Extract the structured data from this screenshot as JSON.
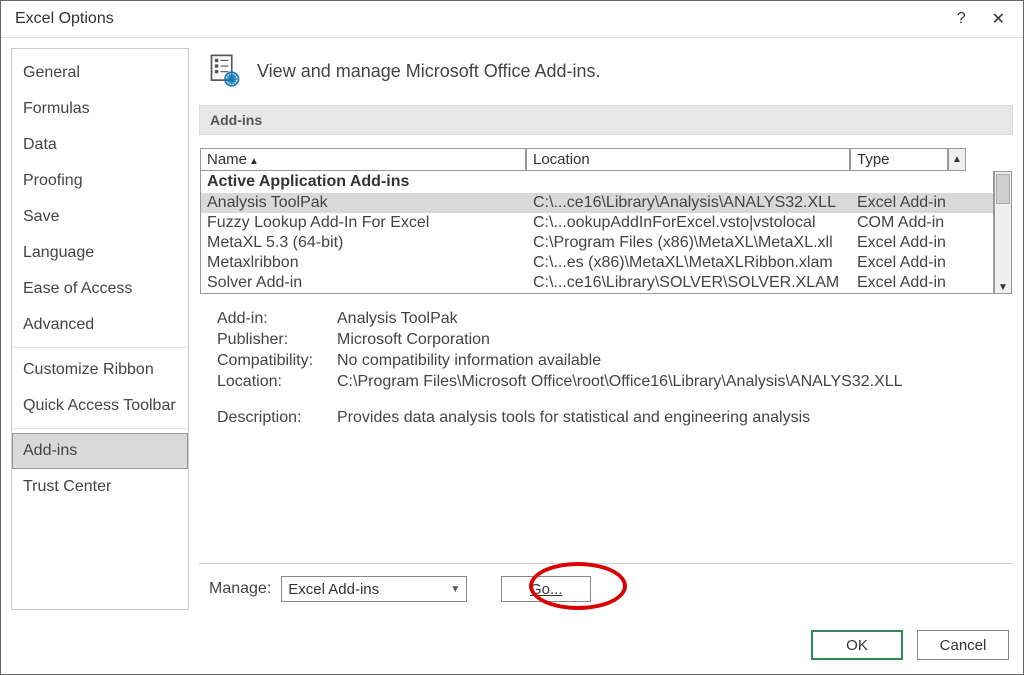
{
  "window": {
    "title": "Excel Options"
  },
  "sidebar": {
    "groups": [
      [
        "General",
        "Formulas",
        "Data",
        "Proofing",
        "Save",
        "Language",
        "Ease of Access",
        "Advanced"
      ],
      [
        "Customize Ribbon",
        "Quick Access Toolbar"
      ],
      [
        "Add-ins",
        "Trust Center"
      ]
    ],
    "selected": "Add-ins"
  },
  "header": {
    "text": "View and manage Microsoft Office Add-ins."
  },
  "section_title": "Add-ins",
  "table": {
    "columns": {
      "name": "Name",
      "location": "Location",
      "type": "Type"
    },
    "group_header": "Active Application Add-ins",
    "rows": [
      {
        "name": "Analysis ToolPak",
        "location": "C:\\...ce16\\Library\\Analysis\\ANALYS32.XLL",
        "type": "Excel Add-in",
        "selected": true
      },
      {
        "name": "Fuzzy Lookup Add-In For Excel",
        "location": "C:\\...ookupAddInForExcel.vsto|vstolocal",
        "type": "COM Add-in",
        "selected": false
      },
      {
        "name": "MetaXL 5.3 (64-bit)",
        "location": "C:\\Program Files (x86)\\MetaXL\\MetaXL.xll",
        "type": "Excel Add-in",
        "selected": false
      },
      {
        "name": "Metaxlribbon",
        "location": "C:\\...es (x86)\\MetaXL\\MetaXLRibbon.xlam",
        "type": "Excel Add-in",
        "selected": false
      },
      {
        "name": "Solver Add-in",
        "location": "C:\\...ce16\\Library\\SOLVER\\SOLVER.XLAM",
        "type": "Excel Add-in",
        "selected": false
      }
    ]
  },
  "details": {
    "labels": {
      "addin": "Add-in:",
      "publisher": "Publisher:",
      "compatibility": "Compatibility:",
      "location": "Location:",
      "description": "Description:"
    },
    "addin": "Analysis ToolPak",
    "publisher": "Microsoft Corporation",
    "compatibility": "No compatibility information available",
    "location": "C:\\Program Files\\Microsoft Office\\root\\Office16\\Library\\Analysis\\ANALYS32.XLL",
    "description": "Provides data analysis tools for statistical and engineering analysis"
  },
  "manage": {
    "label": "Manage:",
    "selected": "Excel Add-ins",
    "go": "Go..."
  },
  "footer": {
    "ok": "OK",
    "cancel": "Cancel"
  }
}
